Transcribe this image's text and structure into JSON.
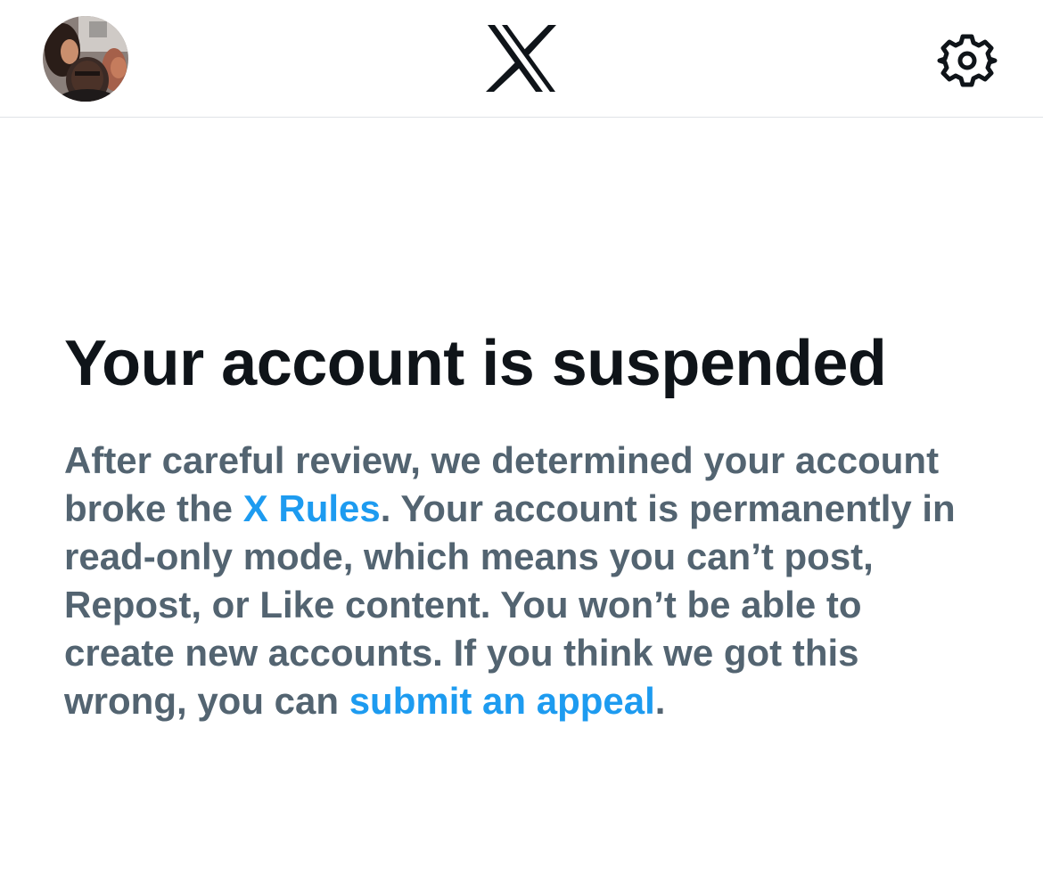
{
  "header": {
    "avatar_icon": "profile-photo",
    "logo_icon": "x-logo",
    "settings_icon": "gear-icon"
  },
  "main": {
    "title": "Your account is suspended",
    "body_before_rules": "After careful review, we determined your account broke the ",
    "rules_link": "X Rules",
    "body_middle": ". Your account is permanently in read-only mode, which means you can’t post, Repost, or Like content. You won’t be able to create new accounts. If you think we got this wrong, you can ",
    "appeal_link": "submit an appeal",
    "body_end": "."
  },
  "colors": {
    "title": "#0f1419",
    "body": "#536471",
    "link": "#1d9bf0",
    "divider": "#dfe3e6",
    "background": "#ffffff"
  }
}
